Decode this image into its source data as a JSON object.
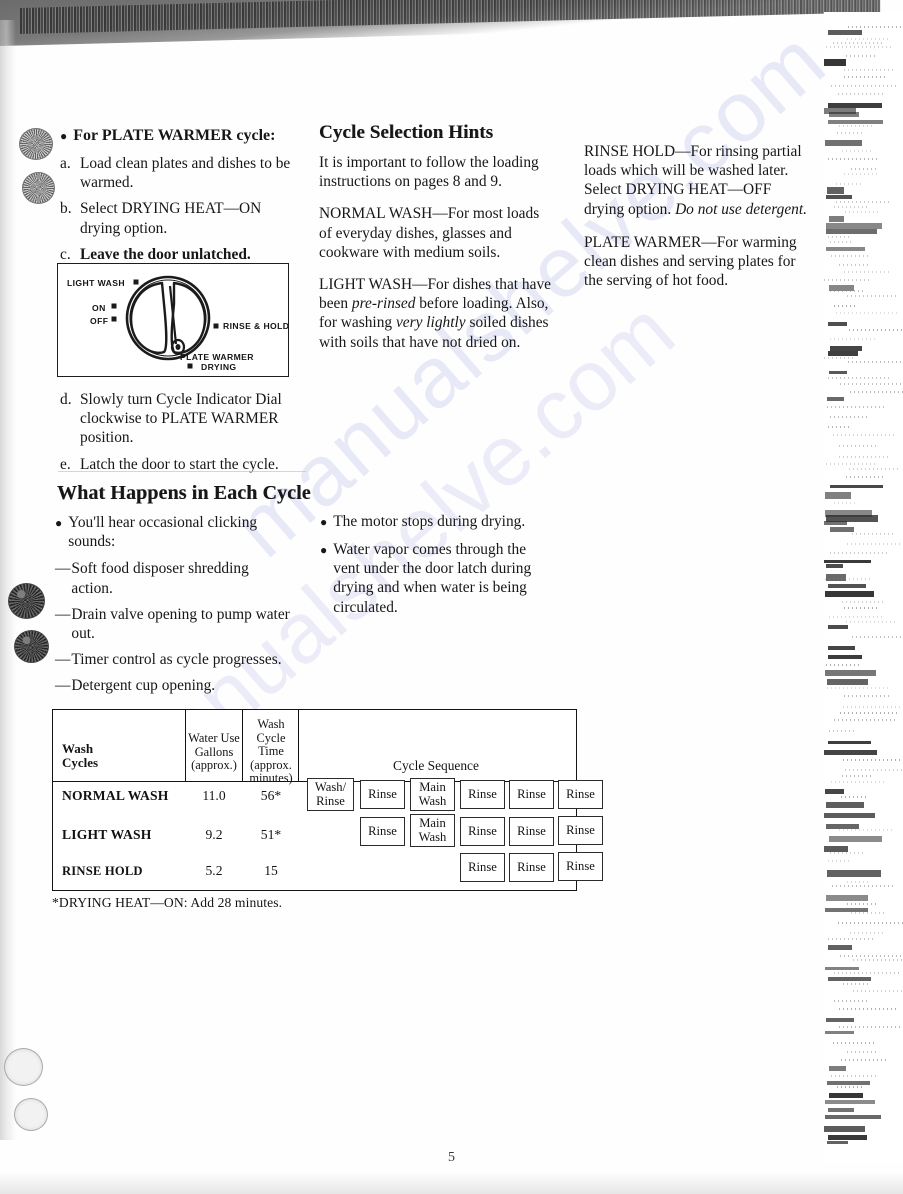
{
  "document": {
    "page_number": "5",
    "watermark": "manualshelve.com"
  },
  "left_column": {
    "plate_warmer_heading": "For PLATE WARMER cycle:",
    "steps": [
      {
        "label": "a.",
        "text": "Load clean plates and dishes to be warmed.",
        "bold": false
      },
      {
        "label": "b.",
        "text": "Select DRYING HEAT—ON drying option.",
        "bold": false
      },
      {
        "label": "c.",
        "text": "Leave the door unlatched.",
        "bold": true
      },
      {
        "label": "d.",
        "text": "Slowly turn Cycle Indicator Dial clockwise to PLATE WARMER position.",
        "bold": false
      },
      {
        "label": "e.",
        "text": "Latch the door to start the cycle.",
        "bold": false
      }
    ],
    "control_panel": {
      "labels": {
        "light_wash": "LIGHT WASH",
        "on": "ON",
        "off": "OFF",
        "rinse_hold": "RINSE & HOLD",
        "plate_warmer": "PLATE WARMER",
        "drying": "DRYING"
      }
    },
    "what_happens_heading": "What Happens in Each Cycle",
    "clicking_intro": "You'll hear occasional clicking sounds:",
    "clicking_items": [
      "Soft food disposer shredding action.",
      "Drain valve opening to pump water out.",
      "Timer control as cycle progresses.",
      "Detergent cup opening."
    ]
  },
  "middle_column": {
    "heading": "Cycle Selection Hints",
    "intro": "It is important to follow the loading instructions on pages 8 and 9.",
    "normal_wash": {
      "term": "NORMAL WASH",
      "dash": "—",
      "text": "For most loads of everyday dishes, glasses and cookware with medium soils."
    },
    "light_wash": {
      "term": "LIGHT WASH",
      "dash": "—",
      "part1": "For dishes that have been ",
      "italic1": "pre-rinsed",
      "part2": " before loading. Also, for washing ",
      "italic2": "very lightly",
      "part3": " soiled dishes with soils that have not dried on."
    },
    "bullets": [
      "The motor stops during drying.",
      "Water vapor comes through the vent under the door latch during drying and when water is being circulated."
    ]
  },
  "right_column": {
    "rinse_hold": {
      "term": "RINSE HOLD",
      "dash": "—",
      "part1": "For rinsing partial loads which will be washed later. Select DRYING HEAT—OFF drying option. ",
      "italic1": "Do not use detergent."
    },
    "plate_warmer": {
      "term": "PLATE WARMER",
      "dash": "—",
      "text": "For warming clean dishes and serving plates for the serving of hot food."
    }
  },
  "table": {
    "headers": {
      "wash_cycles": "Wash\nCycles",
      "wash_cycles_l1": "Wash",
      "wash_cycles_l2": "Cycles",
      "water_use_l1": "Water Use",
      "water_use_l2": "Gallons",
      "water_use_l3": "(approx.)",
      "cycle_time_l1": "Wash",
      "cycle_time_l2": "Cycle Time",
      "cycle_time_l3": "(approx.",
      "cycle_time_l4": "minutes)",
      "cycle_sequence": "Cycle Sequence"
    },
    "rows": [
      {
        "cycle": "NORMAL WASH",
        "water_gallons": "11.0",
        "cycle_minutes": "56*",
        "sequence": [
          "Wash/ Rinse",
          "Rinse",
          "Main Wash",
          "Rinse",
          "Rinse",
          "Rinse"
        ]
      },
      {
        "cycle": "LIGHT WASH",
        "water_gallons": "9.2",
        "cycle_minutes": "51*",
        "sequence": [
          "",
          "Rinse",
          "Main Wash",
          "Rinse",
          "Rinse",
          "Rinse"
        ]
      },
      {
        "cycle": "RINSE HOLD",
        "water_gallons": "5.2",
        "cycle_minutes": "15",
        "sequence": [
          "",
          "",
          "",
          "Rinse",
          "Rinse",
          "Rinse"
        ]
      }
    ],
    "seq_cells": {
      "wash_rinse_l1": "Wash/",
      "wash_rinse_l2": "Rinse",
      "rinse": "Rinse",
      "main_l1": "Main",
      "main_l2": "Wash"
    },
    "footnote": "*DRYING HEAT—ON:  Add 28 minutes."
  }
}
